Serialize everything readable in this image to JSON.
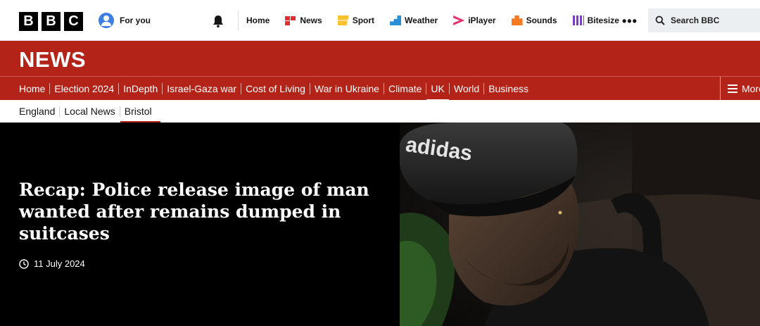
{
  "topbar": {
    "logo_letters": [
      "B",
      "B",
      "C"
    ],
    "for_you": "For you",
    "nav": [
      {
        "label": "Home",
        "icon": "none"
      },
      {
        "label": "News",
        "icon": "news-icon",
        "color": "#e12d2d"
      },
      {
        "label": "Sport",
        "icon": "sport-icon",
        "color": "#f7c22b"
      },
      {
        "label": "Weather",
        "icon": "weather-icon",
        "color": "#2b8fd6"
      },
      {
        "label": "iPlayer",
        "icon": "iplayer-icon",
        "color": "#e3326f"
      },
      {
        "label": "Sounds",
        "icon": "sounds-icon",
        "color": "#f57a21"
      },
      {
        "label": "Bitesize",
        "icon": "bitesize-icon",
        "color": "#7a3ec4"
      }
    ],
    "more_dots": "•••",
    "search_placeholder": "Search BBC"
  },
  "banner": {
    "title": "NEWS",
    "color": "#b42318"
  },
  "section_nav": {
    "items": [
      "Home",
      "Election 2024",
      "InDepth",
      "Israel-Gaza war",
      "Cost of Living",
      "War in Ukraine",
      "Climate",
      "UK",
      "World",
      "Business"
    ],
    "active": "UK",
    "more": "More"
  },
  "sub_nav": {
    "items": [
      "England",
      "Local News",
      "Bristol"
    ],
    "active": "Bristol"
  },
  "hero": {
    "headline": "Recap: Police release image of man wanted after remains dumped in suitcases",
    "date": "11 July 2024",
    "cap_text": "adidas"
  }
}
